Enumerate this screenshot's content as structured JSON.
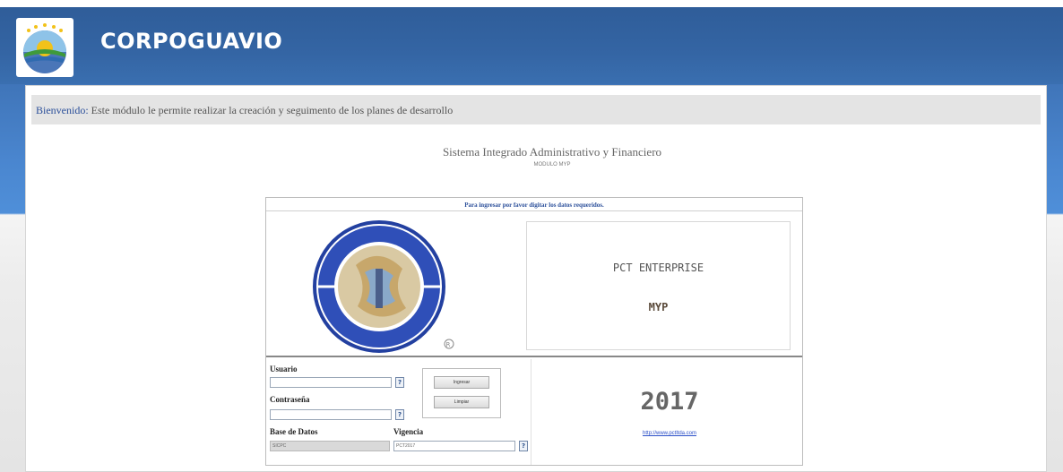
{
  "header": {
    "title": "CORPOGUAVIO",
    "logo_icon": "corpoguavio-logo-icon"
  },
  "welcome": {
    "label": "Bienvenido:",
    "text": " Este módulo le permite realizar la creación y seguimento de los planes de desarrollo"
  },
  "system": {
    "title": "Sistema Integrado Administrativo y Financiero",
    "module": "MODULO MYP"
  },
  "login": {
    "instruction": "Para ingresar por favor digitar los datos requeridos.",
    "seal_icon": "pct-seal-icon",
    "brand": "PCT ENTERPRISE",
    "brand_module": "MYP",
    "year": "2017",
    "link": "http://www.pctltda.com",
    "fields": {
      "user_label": "Usuario",
      "user_value": "",
      "password_label": "Contraseña",
      "password_value": "",
      "database_label": "Base de Datos",
      "database_value": "SICPC",
      "period_label": "Vigencia",
      "period_value": "PCT2017",
      "help_glyph": "?"
    },
    "buttons": {
      "login": "Ingresar",
      "clear": "Limpiar"
    }
  },
  "colors": {
    "header_blue": "#3465a4",
    "welcome_label": "#2b4f9a"
  }
}
